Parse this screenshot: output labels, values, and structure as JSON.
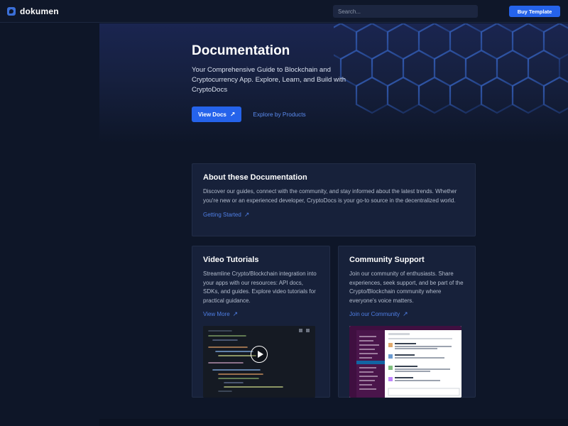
{
  "brand": {
    "name": "dokumen"
  },
  "search": {
    "placeholder": "Search..."
  },
  "header": {
    "buy_label": "Buy Template"
  },
  "hero": {
    "title": "Documentation",
    "subtitle": "Your Comprehensive Guide to Blockchain and Cryptocurrency App. Explore, Learn, and Build with CryptoDocs",
    "view_docs_label": "View Docs",
    "explore_label": "Explore by Products"
  },
  "about": {
    "title": "About these Documentation",
    "text": "Discover our guides, connect with the community, and stay informed about the latest trends. Whether you're new or an experienced developer, CryptoDocs is your go-to source in the decentralized world.",
    "link": "Getting Started"
  },
  "video": {
    "title": "Video Tutorials",
    "text": "Streamline Crypto/Blockchain integration into your apps with our resources: API docs, SDKs, and guides. Explore video tutorials for practical guidance.",
    "link": "View More"
  },
  "community": {
    "title": "Community Support",
    "text": "Join our community of enthusiasts. Share experiences, seek support, and be part of the Crypto/Blockchain community where everyone's voice matters.",
    "link": "Join our Community"
  },
  "icons": {
    "logo": "dokumen-logo-icon",
    "arrow": "arrow-up-right-icon",
    "play": "play-icon"
  },
  "colors": {
    "background": "#0e1628",
    "card": "#17213a",
    "accent": "#2563eb",
    "link": "#4f7fe6"
  }
}
